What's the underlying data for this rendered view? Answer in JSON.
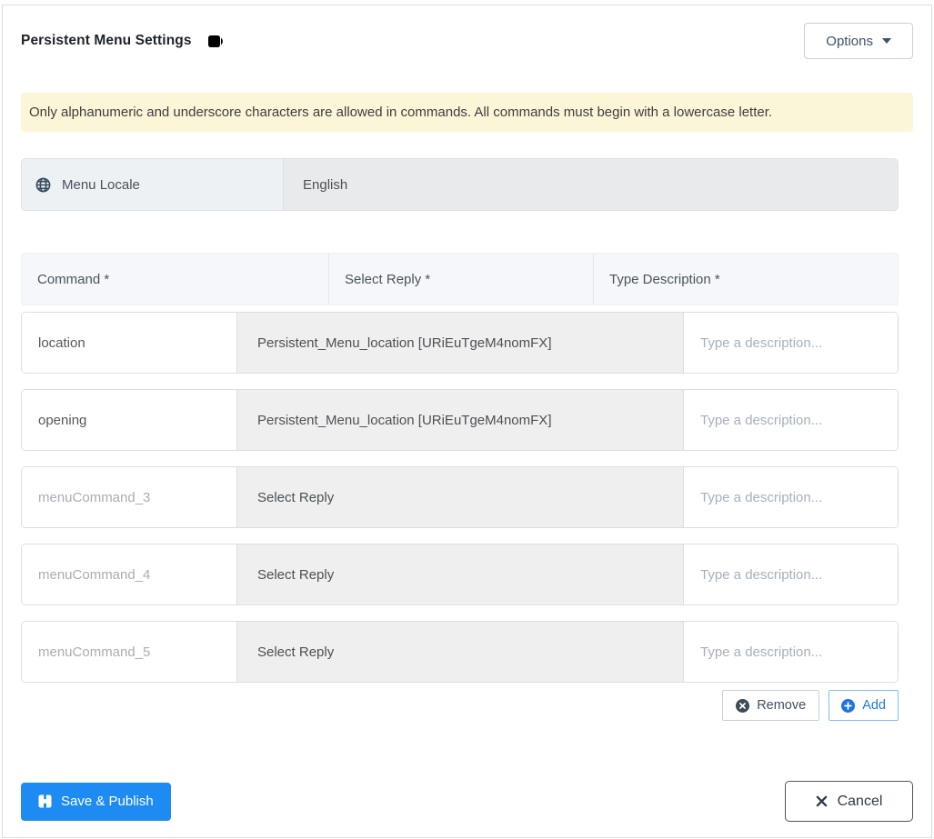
{
  "header": {
    "title": "Persistent Menu Settings",
    "options_button": "Options"
  },
  "banner": {
    "text": "Only alphanumeric and underscore characters are allowed in commands. All commands must begin with a lowercase letter."
  },
  "locale": {
    "label": "Menu Locale",
    "value": "English"
  },
  "table": {
    "columns": [
      "Command *",
      "Select Reply *",
      "Type Description *"
    ],
    "description_placeholder": "Type a description...",
    "rows": [
      {
        "command_value": "location",
        "reply": "Persistent_Menu_location [URiEuTgeM4nomFX]"
      },
      {
        "command_value": "opening",
        "reply": "Persistent_Menu_location [URiEuTgeM4nomFX]"
      },
      {
        "command_placeholder": "menuCommand_3",
        "reply": "Select Reply"
      },
      {
        "command_placeholder": "menuCommand_4",
        "reply": "Select Reply"
      },
      {
        "command_placeholder": "menuCommand_5",
        "reply": "Select Reply"
      }
    ]
  },
  "row_actions": {
    "remove": "Remove",
    "add": "Add"
  },
  "footer": {
    "save": "Save & Publish",
    "cancel": "Cancel"
  },
  "icons": {
    "header": "video-camera-icon",
    "locale": "globe-icon",
    "remove": "x-circle-icon",
    "add": "plus-circle-icon",
    "save": "floppy-disk-icon",
    "cancel": "x-icon",
    "options": "caret-down-icon"
  },
  "colors": {
    "primary_blue": "#1d8bf1",
    "add_blue": "#1f7ae0",
    "add_border_blue": "#7fbcf9",
    "banner_bg": "#fcf6d8",
    "select_cell_bg": "#efefef",
    "table_header_bg": "#f5f7fa",
    "locale_label_bg": "#eef1f4",
    "locale_value_bg": "#e9eaeb",
    "dark_icon": "#3e4a57",
    "border_gray": "#d9dee4"
  }
}
